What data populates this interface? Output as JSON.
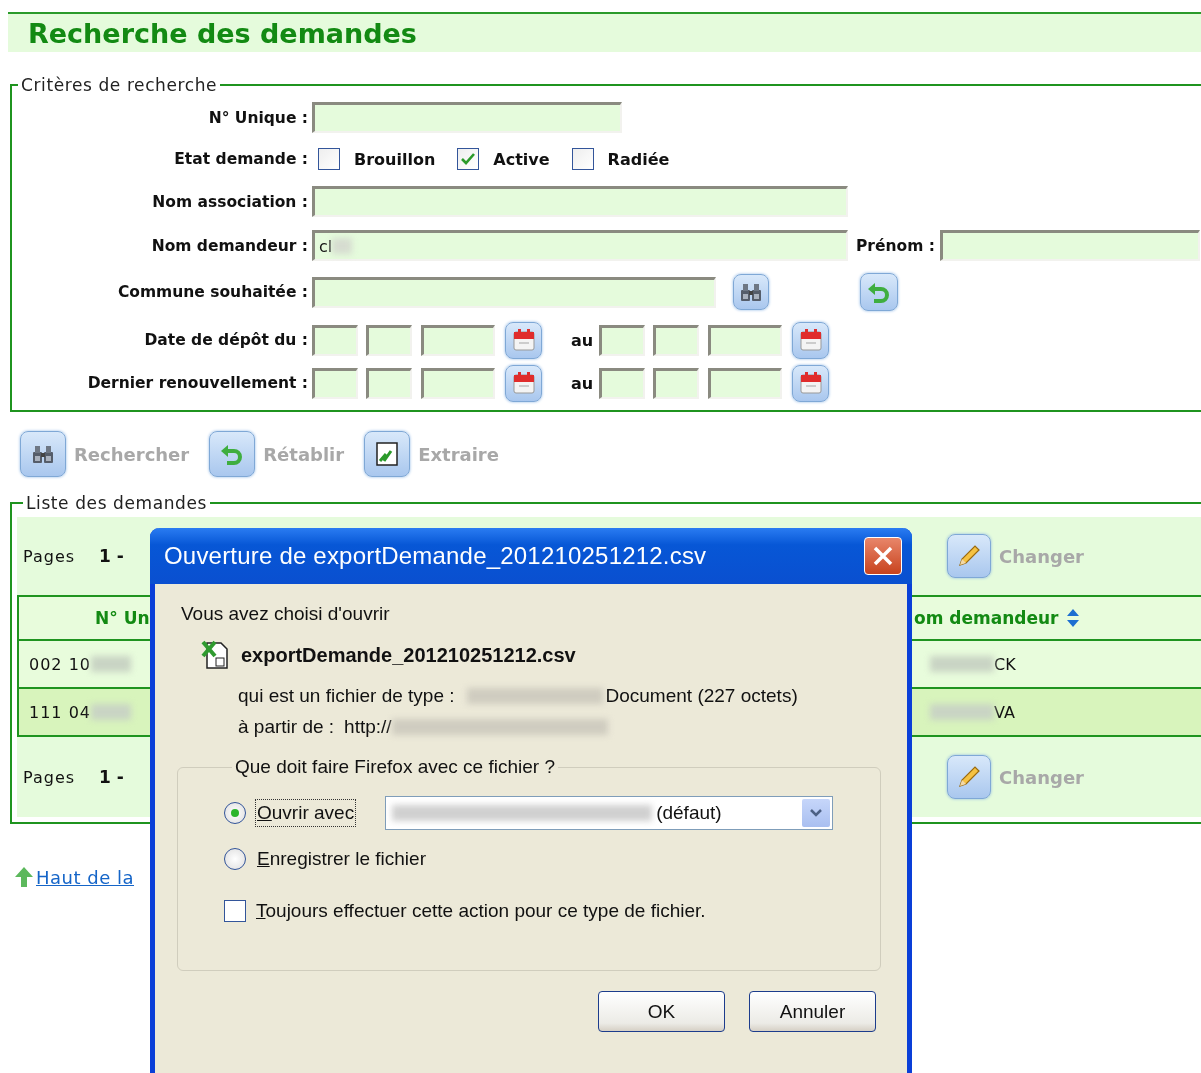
{
  "page_title": "Recherche des demandes",
  "criteria": {
    "legend": "Critères de recherche",
    "unique_number": {
      "label": "N° Unique :"
    },
    "status": {
      "label": "Etat demande :",
      "options": [
        {
          "label": "Brouillon",
          "checked": false
        },
        {
          "label": "Active",
          "checked": true
        },
        {
          "label": "Radiée",
          "checked": false
        }
      ]
    },
    "association_name": {
      "label": "Nom association :"
    },
    "applicant_name": {
      "label": "Nom demandeur :",
      "value": "cl"
    },
    "first_name": {
      "label": "Prénom :"
    },
    "commune": {
      "label": "Commune souhaitée :"
    },
    "date_ranges": [
      {
        "label": "Date de dépôt du :",
        "to_label": "au"
      },
      {
        "label": "Dernier renouvellement :",
        "to_label": "au"
      }
    ]
  },
  "actions": [
    {
      "label": "Rechercher",
      "kind": "search"
    },
    {
      "label": "Rétablir",
      "kind": "reset"
    },
    {
      "label": "Extraire",
      "kind": "export"
    }
  ],
  "list": {
    "legend": "Liste des demandes",
    "pagers": [
      {
        "label": "Pages",
        "page": "1 -",
        "action": "Changer"
      },
      {
        "label": "Pages",
        "page": "1 -",
        "action": "Changer"
      }
    ],
    "columns": [
      "N° Un",
      "om demandeur"
    ],
    "rows": [
      {
        "column_1": "002 10",
        "column_2": "CK",
        "selected": false
      },
      {
        "column_1": "111 04",
        "column_2": "VA",
        "selected": true
      }
    ]
  },
  "back_to_top": "Haut de la",
  "dialog": {
    "title": "Ouverture de exportDemande_201210251212.csv",
    "intro": "Vous avez choisi d'ouvrir",
    "file_name": "exportDemande_201210251212.csv",
    "type_label": "qui est un fichier de type :",
    "type_value": "Document (227 octets)",
    "from_label": "à partir de :",
    "from_value": "http://",
    "group_legend": "Que doit faire Firefox avec ce fichier ?",
    "options": [
      {
        "label": "Ouvrir avec",
        "selected": true,
        "app": "(défaut)"
      },
      {
        "label": "Enregistrer le fichier",
        "selected": false
      }
    ],
    "always": {
      "label": "Toujours effectuer cette action pour ce type de fichier.",
      "checked": false
    },
    "buttons": [
      "OK",
      "Annuler"
    ]
  }
}
